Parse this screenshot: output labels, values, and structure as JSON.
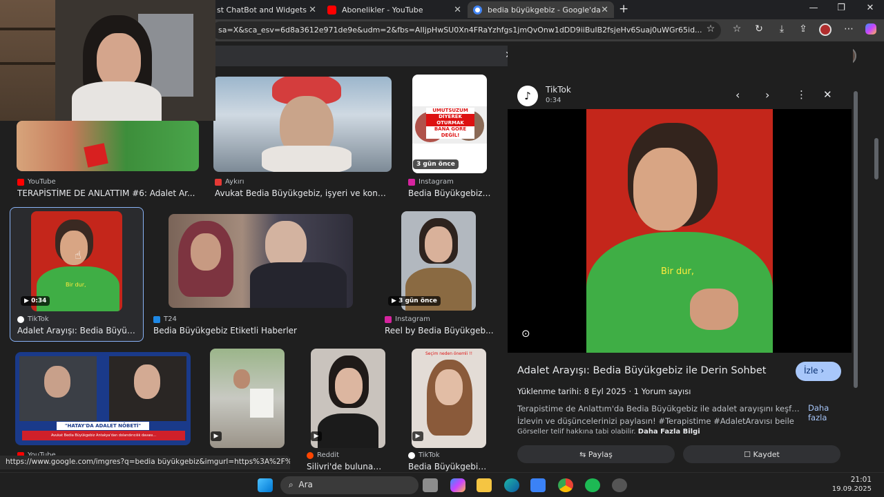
{
  "browser": {
    "tabs": [
      {
        "label": "st ChatBot and Widgets fo",
        "color": "#e8e8e8"
      },
      {
        "label": "Abonelikler - YouTube",
        "color": "#ff0000"
      },
      {
        "label": "bedia büyükgebiz - Google'da Ar",
        "color": "#4285f4",
        "active": true
      }
    ],
    "new_tab_icon": "plus-icon",
    "url": "sa=X&sca_esv=6d8a3612e971de9e&udm=2&fbs=AIIjpHwSU0Xn4FRaYzhfgs1jmQvOnw1dDD9iiBuIB2fsjeHv6Suaj0uWGr65id..."
  },
  "results": [
    {
      "source": "YouTube",
      "caption": "TERAPİSTİME DE ANLATTIM #6: Adalet Ar...",
      "color": "#ff0000"
    },
    {
      "source": "Aykırı",
      "caption": "Avukat Bedia Büyükgebiz, işyeri ve konutl...",
      "color": "#e53935"
    },
    {
      "source": "Instagram",
      "caption": "Bedia Büyükgebiz ...",
      "color": "#d6249f",
      "badge": "3 gün önce",
      "overlay": [
        "UMUTSUZUM",
        "DİYEREK",
        "OTURMAK",
        "BANA GÖRE",
        "DEĞİL!"
      ]
    },
    {
      "source": "TikTok",
      "caption": "Adalet Arayışı: Bedia Büyük...",
      "color": "#ffffff",
      "badge": "0:34",
      "subtitle": "Bir dur,"
    },
    {
      "source": "T24",
      "caption": "Bedia Büyükgebiz Etiketli Haberler",
      "color": "#1e88e5"
    },
    {
      "source": "Instagram",
      "caption": "Reel by Bedia Büyükgeb...",
      "color": "#d6249f",
      "badge": "3 gün önce"
    },
    {
      "source": "YouTube",
      "caption": "",
      "color": "#ff0000",
      "banner": "\"HATAY'DA ADALET NÖBETİ\"",
      "banner_sub": "Avukat Bedia Büyükgebiz Antakya'dan dolandırıcılık davası..."
    },
    {
      "source": "",
      "caption": "",
      "color": ""
    },
    {
      "source": "Reddit",
      "caption": "Silivri'de bulunan A...",
      "color": "#ff4500"
    },
    {
      "source": "TikTok",
      "caption": "Bedia Büyükgebiz ...",
      "color": "#ffffff",
      "top_text": "Seçim neden önemli !!"
    }
  ],
  "panel": {
    "source": "TikTok",
    "duration": "0:34",
    "subtitle": "Bir dur,",
    "title": "Adalet Arayışı: Bedia Büyükgebiz ile Derin Sohbet",
    "watch_label": "İzle",
    "upload": "Yüklenme tarihi: 8 Eyl 2025",
    "comments": "1 Yorum sayısı",
    "desc1": "Terapistime de Anlattım'da Bedia Büyükgebiz ile adalet arayışını keşfedin...",
    "desc2": "İzlevin ve düşüncelerinizi paylasın! #Terapistime #AdaletAravısı beile",
    "more_label": "Daha fazla",
    "copyright": "Görseller telif hakkına tabi olabilir.",
    "more_info": "Daha Fazla Bilgi",
    "share_label": "Paylaş",
    "save_label": "Kaydet"
  },
  "status_url": "https://www.google.com/imgres?q=bedia büyükgebiz&imgurl=https%3A%2F%2Fww...",
  "taskbar": {
    "search_placeholder": "Ara",
    "time": "21:01",
    "date": "19.09.2025"
  },
  "colors": {
    "accent": "#a8c7fa",
    "panel_bg": "#1f1f1f",
    "green_shirt": "#3fae45",
    "red_bg": "#c4261b"
  }
}
